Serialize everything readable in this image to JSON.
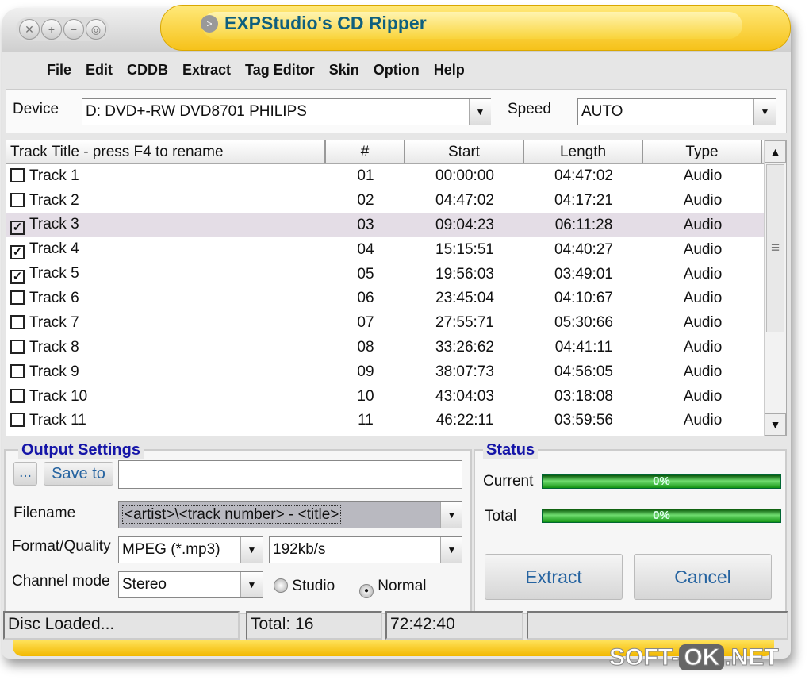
{
  "window": {
    "title": "EXPStudio's CD Ripper"
  },
  "menu": [
    "File",
    "Edit",
    "CDDB",
    "Extract",
    "Tag Editor",
    "Skin",
    "Option",
    "Help"
  ],
  "device": {
    "label": "Device",
    "value": "D: DVD+-RW DVD8701  PHILIPS",
    "speed_label": "Speed",
    "speed_value": "AUTO"
  },
  "table": {
    "headers": [
      "Track Title - press F4 to rename",
      "#",
      "Start",
      "Length",
      "Type"
    ],
    "rows": [
      {
        "title": "Track 1",
        "num": "01",
        "start": "00:00:00",
        "length": "04:47:02",
        "type": "Audio",
        "checked": false
      },
      {
        "title": "Track 2",
        "num": "02",
        "start": "04:47:02",
        "length": "04:17:21",
        "type": "Audio",
        "checked": false
      },
      {
        "title": "Track 3",
        "num": "03",
        "start": "09:04:23",
        "length": "06:11:28",
        "type": "Audio",
        "checked": true
      },
      {
        "title": "Track 4",
        "num": "04",
        "start": "15:15:51",
        "length": "04:40:27",
        "type": "Audio",
        "checked": true
      },
      {
        "title": "Track 5",
        "num": "05",
        "start": "19:56:03",
        "length": "03:49:01",
        "type": "Audio",
        "checked": true
      },
      {
        "title": "Track 6",
        "num": "06",
        "start": "23:45:04",
        "length": "04:10:67",
        "type": "Audio",
        "checked": false
      },
      {
        "title": "Track 7",
        "num": "07",
        "start": "27:55:71",
        "length": "05:30:66",
        "type": "Audio",
        "checked": false
      },
      {
        "title": "Track 8",
        "num": "08",
        "start": "33:26:62",
        "length": "04:41:11",
        "type": "Audio",
        "checked": false
      },
      {
        "title": "Track 9",
        "num": "09",
        "start": "38:07:73",
        "length": "04:56:05",
        "type": "Audio",
        "checked": false
      },
      {
        "title": "Track 10",
        "num": "10",
        "start": "43:04:03",
        "length": "03:18:08",
        "type": "Audio",
        "checked": false
      },
      {
        "title": "Track 11",
        "num": "11",
        "start": "46:22:11",
        "length": "03:59:56",
        "type": "Audio",
        "checked": false
      }
    ]
  },
  "output": {
    "title": "Output Settings",
    "browse": "...",
    "save_to": "Save to",
    "save_path": "",
    "filename_label": "Filename",
    "filename": "<artist>\\<track number> - <title>",
    "format_label": "Format/Quality",
    "format": "MPEG (*.mp3)",
    "quality": "192kb/s",
    "channel_label": "Channel mode",
    "channel": "Stereo",
    "studio": "Studio",
    "normal": "Normal"
  },
  "status": {
    "title": "Status",
    "current_label": "Current",
    "current": "0%",
    "total_label": "Total",
    "total": "0%",
    "extract": "Extract",
    "cancel": "Cancel"
  },
  "statusbar": {
    "msg": "Disc Loaded...",
    "total": "Total: 16",
    "time": "72:42:40"
  },
  "watermark": {
    "a": "SOFT-",
    "b": "OK",
    ".net": ".NET"
  }
}
